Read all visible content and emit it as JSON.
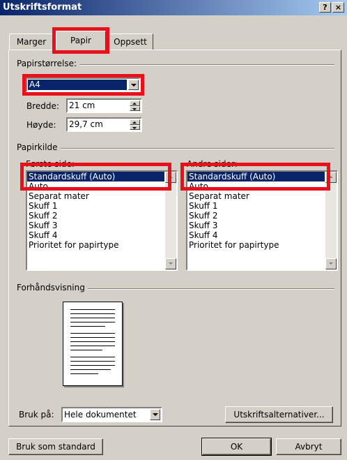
{
  "window": {
    "title": "Utskriftsformat",
    "help_label": "?",
    "close_label": "×"
  },
  "tabs": [
    {
      "label": "Marger"
    },
    {
      "label": "Papir"
    },
    {
      "label": "Oppsett"
    }
  ],
  "paper_size": {
    "group_label": "Papirstørrelse:",
    "selected": "A4",
    "width_label": "Bredde:",
    "width_value": "21 cm",
    "height_label": "Høyde:",
    "height_value": "29,7 cm"
  },
  "paper_source": {
    "group_label": "Papirkilde",
    "first_page_label": "Første side:",
    "other_pages_label": "Andre sider:",
    "items": [
      "Standardskuff (Auto)",
      "Auto",
      "Separat mater",
      "Skuff 1",
      "Skuff 2",
      "Skuff 3",
      "Skuff 4",
      "Prioritet for papirtype"
    ]
  },
  "preview": {
    "group_label": "Forhåndsvisning"
  },
  "apply_to": {
    "label": "Bruk på:",
    "value": "Hele dokumentet"
  },
  "buttons": {
    "print_options": "Utskriftsalternativer...",
    "default": "Bruk som standard",
    "ok": "OK",
    "cancel": "Avbryt"
  },
  "colors": {
    "highlight_outline": "#e8101b",
    "selection": "#0a246a",
    "titlebar": "#0a246a"
  }
}
